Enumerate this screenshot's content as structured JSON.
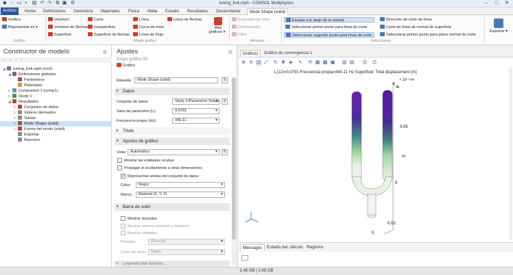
{
  "window": {
    "title": "tuning_fork.mph - COMSOL Multiphysics",
    "controls": [
      "–",
      "□",
      "✕"
    ]
  },
  "tabs": {
    "file": "Archivo ▾",
    "items": [
      "Home",
      "Definiciones",
      "Geometría",
      "Materiales",
      "Física",
      "Malla",
      "Estudio",
      "Resultados",
      "Desarrollador"
    ],
    "active": "Mode Shape (solid)"
  },
  "ribbon": {
    "grafico": {
      "plot": "Gráfico",
      "plot_in": "Representar en ▾",
      "group": "Gráfico"
    },
    "anadir": {
      "volumen": "Volumen",
      "corte": "Corte",
      "linea": "Línea",
      "linea_flechas": "Línea de flechas",
      "vol_flechas": "Volumen de flechas",
      "isosuperficie": "Isosuperficie",
      "curva_nivel": "Curva de nivel",
      "superficie": "Superficie",
      "superficie_flechas": "Superficie de flechas",
      "linea_flujo": "Línea de Flujo",
      "mas": "Más",
      "mas2": "gráficos ▾",
      "group": "Añadir gráfico"
    },
    "atributos": {
      "a1": "Expresión de color",
      "a2": "Deformación",
      "a3": "Filtro",
      "group": "Atributos"
    },
    "selecciones": {
      "s1": "Escalar a lo largo de la normal",
      "s2": "Seleccionar primer punto para línea de corte",
      "s3": "Seleccionar segundo punto para línea de corte",
      "s4": "Dirección de corte de línea",
      "s5": "Corte de línea de normal de superficie",
      "s6": "Seleccionar primer punto para plano normal de corte",
      "group": "Selecciones"
    },
    "exportar": "Exportar ▾"
  },
  "model_builder": {
    "title": "Constructor de modelo",
    "items": [
      {
        "label": "tuning_fork.mph (root)",
        "indent": 0,
        "arrow": "◢",
        "color": "#5b7aa6"
      },
      {
        "label": "Definiciones globales",
        "indent": 1,
        "arrow": "◢",
        "color": "#6a6a6a"
      },
      {
        "label": "Parámetros",
        "indent": 2,
        "arrow": "",
        "color": "#b04a3a"
      },
      {
        "label": "Materiales",
        "indent": 2,
        "arrow": "",
        "color": "#c99a2e"
      },
      {
        "label": "Component 1 (comp1)",
        "indent": 1,
        "arrow": "▷",
        "color": "#6e8fb8"
      },
      {
        "label": "Study 1",
        "indent": 1,
        "arrow": "▷",
        "color": "#5a8c5a"
      },
      {
        "label": "Resultados",
        "indent": 1,
        "arrow": "◢",
        "color": "#b04a3a"
      },
      {
        "label": "Conjuntos de datos",
        "indent": 2,
        "arrow": "▷",
        "color": "#b04a3a"
      },
      {
        "label": "Valores derivados",
        "indent": 2,
        "arrow": "▷",
        "color": "#8a8a8a"
      },
      {
        "label": "Tablas",
        "indent": 2,
        "arrow": "▷",
        "color": "#8a8a8a"
      },
      {
        "label": "Mode Shape (solid)",
        "indent": 2,
        "arrow": "▷",
        "color": "#b04a3a",
        "selected": true
      },
      {
        "label": "Forma del modo (solid)",
        "indent": 2,
        "arrow": "▷",
        "color": "#b04a3a"
      },
      {
        "label": "Exportar",
        "indent": 2,
        "arrow": "",
        "color": "#8a8a8a"
      },
      {
        "label": "Reportes",
        "indent": 2,
        "arrow": "",
        "color": "#8a8a8a"
      }
    ]
  },
  "settings": {
    "title": "Ajustes",
    "subtitle": "Grupo gráfico 3D",
    "plot_btn": "Gráfico",
    "etiqueta_label": "Etiqueta:",
    "etiqueta_value": "Mode Shape (solid)",
    "datos": {
      "header": "Datos",
      "conjunto_label": "Conjunto de datos:",
      "conjunto_value": "Study 1/Parametric Solutio",
      "valor_label": "Valor de parámetro (L):",
      "valor_value": "0.0791",
      "freq_label": "Frecuencia propia (Hz):",
      "freq_value": "440.11"
    },
    "titulo": "Título",
    "ajustes": {
      "header": "Ajustes de gráfico",
      "vista_label": "Vista:",
      "vista_value": "Automático",
      "chk1": "Mostrar las entidades ocultas",
      "chk2": "Propagar el ocultamiento a otras dimensiones",
      "chk3": "Representar aristas del conjunto de datos",
      "color_label": "Color:",
      "color_value": "Negro",
      "marco_label": "Marco:",
      "marco_value": "Material (X, Y, Z)"
    },
    "barra": {
      "header": "Barra de color",
      "chk1": "Mostrar leyendas",
      "chk2": "Mostrar valores mínimos y máximos",
      "chk3": "Mostrar unidades",
      "pos_label": "Posición:",
      "pos_value": "Derecha",
      "color_label": "Color del texto:",
      "color_value": "Negro"
    },
    "cut_header": "Leyenda del número..."
  },
  "graphics": {
    "tabs": [
      "Gráficos",
      "Gráfico de convergencia 1"
    ],
    "plot_title": "L(12)=0.0791 Frecuencia propia=440.11 Hz   Superficie: Total displacement (m)",
    "exp_label": "× 10⁻³ m",
    "y_ticks": [
      "4",
      "-4"
    ],
    "axis_ticks": [
      "0.05",
      "0",
      "0.02",
      "0"
    ],
    "axis_unit": "m"
  },
  "messages": {
    "tabs": [
      "Mensajes",
      "Estado del cálculo",
      "Registro"
    ]
  },
  "status": {
    "memory": "1.46 GB | 1.65 GB"
  }
}
